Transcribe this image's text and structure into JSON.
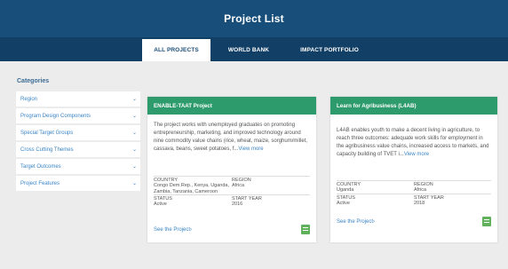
{
  "header": {
    "title": "Project List"
  },
  "tabs": [
    {
      "label": "ALL PROJECTS"
    },
    {
      "label": "WORLD BANK"
    },
    {
      "label": "IMPACT PORTFOLIO"
    }
  ],
  "sidebar": {
    "title": "Categories",
    "items": [
      {
        "label": "Region"
      },
      {
        "label": "Program Design Components"
      },
      {
        "label": "Special Target Groups"
      },
      {
        "label": "Cross Cutting Themes"
      },
      {
        "label": "Target Outcomes"
      },
      {
        "label": "Project Features"
      }
    ]
  },
  "projects": [
    {
      "title": "ENABLE-TAAT Project",
      "description": "The project works with unemployed graduates on promoting entrepreneurship, marketing, and improved technology around nine commodity value chains (rice, wheat, maize, sorghum/millet, cassava, beans, sweet potatoes, f...",
      "view_more": "View more",
      "country_label": "COUNTRY",
      "country_value": "Congo Dem.Rep., Kenya, Uganda, Zambia, Tanzania, Cameroon",
      "region_label": "REGION",
      "region_value": "Africa",
      "status_label": "STATUS",
      "status_value": "Active",
      "start_label": "START YEAR",
      "start_value": "2016",
      "see_link": "See the Project›"
    },
    {
      "title": "Learn for Agribusiness (L4AB)",
      "description": "L4AB enables youth to make a decent living in agriculture, to reach three outcomes: adequate work skills for employment in the agribusiness value chains, increased access to markets, and capacity building of TVET i...",
      "view_more": "View more",
      "country_label": "COUNTRY",
      "country_value": "Uganda",
      "region_label": "REGION",
      "region_value": "Africa",
      "status_label": "STATUS",
      "status_value": "Active",
      "start_label": "START YEAR",
      "start_value": "2018",
      "see_link": "See the Project›"
    }
  ],
  "icons": {
    "chevron": "chevron-down-icon",
    "document": "document-icon"
  },
  "colors": {
    "header_bg": "#174e7a",
    "tabbar_bg": "#123f66",
    "card_header": "#2e9b6c",
    "link": "#3a85c6",
    "doc_icon": "#5fb15b"
  }
}
